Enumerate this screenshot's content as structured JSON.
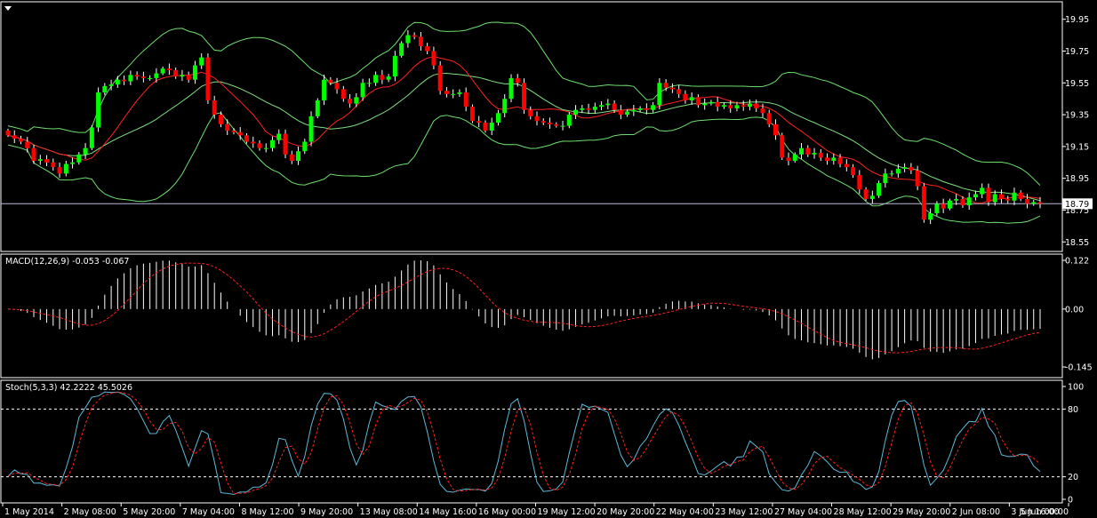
{
  "colors": {
    "background": "#000000",
    "frame": "#ffffff",
    "bull": "#00ff00",
    "bear": "#ff0000",
    "wick": "#ffffff",
    "band_outer": "#6ddf6d",
    "band_mid": "#7fdf7f",
    "ma": "#ff2020",
    "macd_hist": "#ffffff",
    "macd_signal": "#ff2020",
    "stoch_main": "#5fb8d8",
    "stoch_signal": "#ff2020",
    "level_line": "#b8b8d8",
    "price_tag_bg": "#ffffff",
    "price_tag_text": "#000000"
  },
  "chart_data": {
    "type": "candlestick",
    "current_price": "18.79",
    "price_ticks": [
      "19.95",
      "19.75",
      "19.55",
      "19.35",
      "19.15",
      "18.95",
      "18.75",
      "18.55"
    ],
    "price_ylim": [
      18.49,
      20.06
    ],
    "time_labels": [
      "1 May 2014",
      "2 May 08:00",
      "5 May 20:00",
      "7 May 04:00",
      "8 May 12:00",
      "9 May 20:00",
      "13 May 08:00",
      "14 May 16:00",
      "16 May 00:00",
      "19 May 12:00",
      "20 May 20:00",
      "22 May 04:00",
      "23 May 12:00",
      "27 May 04:00",
      "28 May 12:00",
      "29 May 20:00",
      "2 Jun 08:00",
      "3 Jun 16:00",
      "5 Jun 00:00"
    ],
    "price_series": {
      "closes": [
        19.22,
        19.2,
        19.18,
        19.14,
        19.06,
        19.07,
        19.05,
        19.02,
        18.98,
        19.04,
        19.05,
        19.1,
        19.14,
        19.27,
        19.49,
        19.53,
        19.54,
        19.57,
        19.56,
        19.6,
        19.59,
        19.58,
        19.58,
        19.61,
        19.64,
        19.63,
        19.59,
        19.6,
        19.57,
        19.66,
        19.71,
        19.44,
        19.35,
        19.29,
        19.25,
        19.24,
        19.22,
        19.18,
        19.17,
        19.14,
        19.14,
        19.19,
        19.23,
        19.1,
        19.06,
        19.12,
        19.18,
        19.34,
        19.44,
        19.57,
        19.55,
        19.51,
        19.45,
        19.42,
        19.46,
        19.55,
        19.55,
        19.6,
        19.57,
        19.59,
        19.72,
        19.8,
        19.85,
        19.84,
        19.78,
        19.75,
        19.66,
        19.5,
        19.48,
        19.48,
        19.49,
        19.4,
        19.31,
        19.3,
        19.25,
        19.3,
        19.36,
        19.45,
        19.58,
        19.55,
        19.38,
        19.34,
        19.31,
        19.3,
        19.29,
        19.28,
        19.28,
        19.35,
        19.38,
        19.39,
        19.38,
        19.4,
        19.41,
        19.42,
        19.38,
        19.35,
        19.37,
        19.38,
        19.39,
        19.38,
        19.41,
        19.55,
        19.52,
        19.51,
        19.48,
        19.44,
        19.46,
        19.41,
        19.42,
        19.43,
        19.4,
        19.41,
        19.39,
        19.41,
        19.4,
        19.42,
        19.39,
        19.36,
        19.29,
        19.22,
        19.08,
        19.06,
        19.1,
        19.14,
        19.1,
        19.11,
        19.08,
        19.06,
        19.08,
        19.04,
        19.02,
        18.97,
        18.88,
        18.82,
        18.84,
        18.92,
        18.98,
        18.98,
        19.01,
        19.02,
        19.0,
        18.9,
        18.69,
        18.73,
        18.79,
        18.76,
        18.81,
        18.82,
        18.78,
        18.83,
        18.85,
        18.89,
        18.8,
        18.85,
        18.82,
        18.81,
        18.86,
        18.82,
        18.79,
        18.8,
        18.79
      ]
    },
    "macd": {
      "title": "MACD(12,26,9) -0.053 -0.067",
      "ticks": [
        "0.122",
        "0.00",
        "-0.145"
      ],
      "ylim": [
        -0.145,
        0.122
      ]
    },
    "stochastic": {
      "title": "Stoch(5,3,3) 42.2222 45.5026",
      "ticks": [
        "100",
        "80",
        "20",
        "0"
      ],
      "levels": [
        80,
        20
      ]
    }
  }
}
